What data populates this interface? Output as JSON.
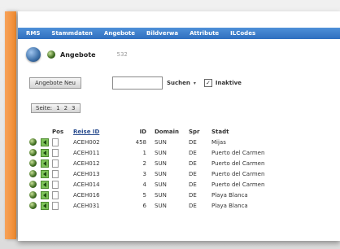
{
  "nav": {
    "items": [
      "RMS",
      "Stammdaten",
      "Angebote",
      "Bildverwa",
      "Attribute",
      "ILCodes"
    ]
  },
  "header": {
    "title": "Angebote",
    "count": "532"
  },
  "toolbar": {
    "new_label": "Angebote Neu",
    "search_value": "",
    "search_label": "Suchen",
    "inactive_label": "Inaktive",
    "inactive_checked": true
  },
  "pager": {
    "items": [
      "Seite:",
      "1",
      "2",
      "3"
    ]
  },
  "table": {
    "columns": [
      "Pos",
      "Reise ID",
      "ID",
      "Domain",
      "Spr",
      "Stadt"
    ],
    "rows": [
      {
        "reise_id": "ACEH002",
        "id": "458",
        "domain": "SUN",
        "spr": "DE",
        "stadt": "Mijas"
      },
      {
        "reise_id": "ACEH011",
        "id": "1",
        "domain": "SUN",
        "spr": "DE",
        "stadt": "Puerto del Carmen"
      },
      {
        "reise_id": "ACEH012",
        "id": "2",
        "domain": "SUN",
        "spr": "DE",
        "stadt": "Puerto del Carmen"
      },
      {
        "reise_id": "ACEH013",
        "id": "3",
        "domain": "SUN",
        "spr": "DE",
        "stadt": "Puerto del Carmen"
      },
      {
        "reise_id": "ACEH014",
        "id": "4",
        "domain": "SUN",
        "spr": "DE",
        "stadt": "Puerto del Carmen"
      },
      {
        "reise_id": "ACEH016",
        "id": "5",
        "domain": "SUN",
        "spr": "DE",
        "stadt": "Playa Blanca"
      },
      {
        "reise_id": "ACEH031",
        "id": "6",
        "domain": "SUN",
        "spr": "DE",
        "stadt": "Playa Blanca"
      }
    ]
  },
  "icons": {
    "globe": "globe-icon",
    "status": "green-circle-icon",
    "move": "green-arrow-icon",
    "doc": "document-icon",
    "search_caret": "caret-down-icon",
    "checkbox": "checkbox-icon"
  },
  "colors": {
    "nav_bg": "#3b7ccc",
    "sidebar": "#f29a45",
    "link": "#2a4d8f"
  }
}
